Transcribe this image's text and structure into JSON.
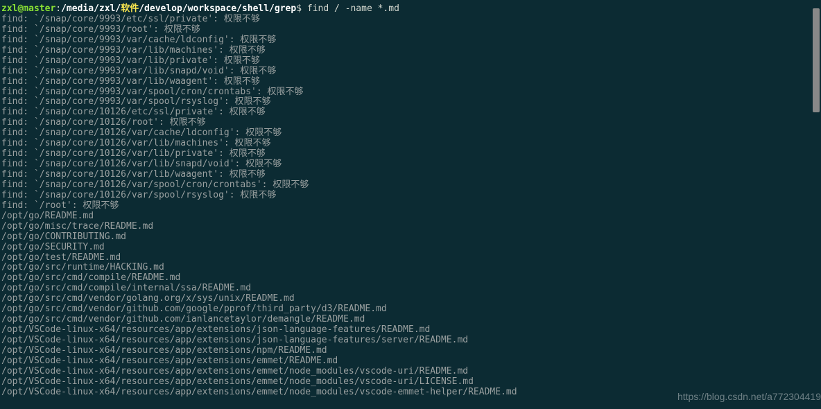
{
  "prompt": {
    "user_host": "zxl@master",
    "path_white1": "/media/zxl/",
    "path_yellow": "软件",
    "path_white2": "/develop/workspace/shell/grep",
    "dollar": "$",
    "command": " find / -name *.md"
  },
  "errors": [
    "find: `/snap/core/9993/etc/ssl/private': 权限不够",
    "find: `/snap/core/9993/root': 权限不够",
    "find: `/snap/core/9993/var/cache/ldconfig': 权限不够",
    "find: `/snap/core/9993/var/lib/machines': 权限不够",
    "find: `/snap/core/9993/var/lib/private': 权限不够",
    "find: `/snap/core/9993/var/lib/snapd/void': 权限不够",
    "find: `/snap/core/9993/var/lib/waagent': 权限不够",
    "find: `/snap/core/9993/var/spool/cron/crontabs': 权限不够",
    "find: `/snap/core/9993/var/spool/rsyslog': 权限不够",
    "find: `/snap/core/10126/etc/ssl/private': 权限不够",
    "find: `/snap/core/10126/root': 权限不够",
    "find: `/snap/core/10126/var/cache/ldconfig': 权限不够",
    "find: `/snap/core/10126/var/lib/machines': 权限不够",
    "find: `/snap/core/10126/var/lib/private': 权限不够",
    "find: `/snap/core/10126/var/lib/snapd/void': 权限不够",
    "find: `/snap/core/10126/var/lib/waagent': 权限不够",
    "find: `/snap/core/10126/var/spool/cron/crontabs': 权限不够",
    "find: `/snap/core/10126/var/spool/rsyslog': 权限不够",
    "find: `/root': 权限不够"
  ],
  "results": [
    "/opt/go/README.md",
    "/opt/go/misc/trace/README.md",
    "/opt/go/CONTRIBUTING.md",
    "/opt/go/SECURITY.md",
    "/opt/go/test/README.md",
    "/opt/go/src/runtime/HACKING.md",
    "/opt/go/src/cmd/compile/README.md",
    "/opt/go/src/cmd/compile/internal/ssa/README.md",
    "/opt/go/src/cmd/vendor/golang.org/x/sys/unix/README.md",
    "/opt/go/src/cmd/vendor/github.com/google/pprof/third_party/d3/README.md",
    "/opt/go/src/cmd/vendor/github.com/ianlancetaylor/demangle/README.md",
    "/opt/VSCode-linux-x64/resources/app/extensions/json-language-features/README.md",
    "/opt/VSCode-linux-x64/resources/app/extensions/json-language-features/server/README.md",
    "/opt/VSCode-linux-x64/resources/app/extensions/npm/README.md",
    "/opt/VSCode-linux-x64/resources/app/extensions/emmet/README.md",
    "/opt/VSCode-linux-x64/resources/app/extensions/emmet/node_modules/vscode-uri/README.md",
    "/opt/VSCode-linux-x64/resources/app/extensions/emmet/node_modules/vscode-uri/LICENSE.md",
    "/opt/VSCode-linux-x64/resources/app/extensions/emmet/node_modules/vscode-emmet-helper/README.md"
  ],
  "watermark": "https://blog.csdn.net/a772304419"
}
